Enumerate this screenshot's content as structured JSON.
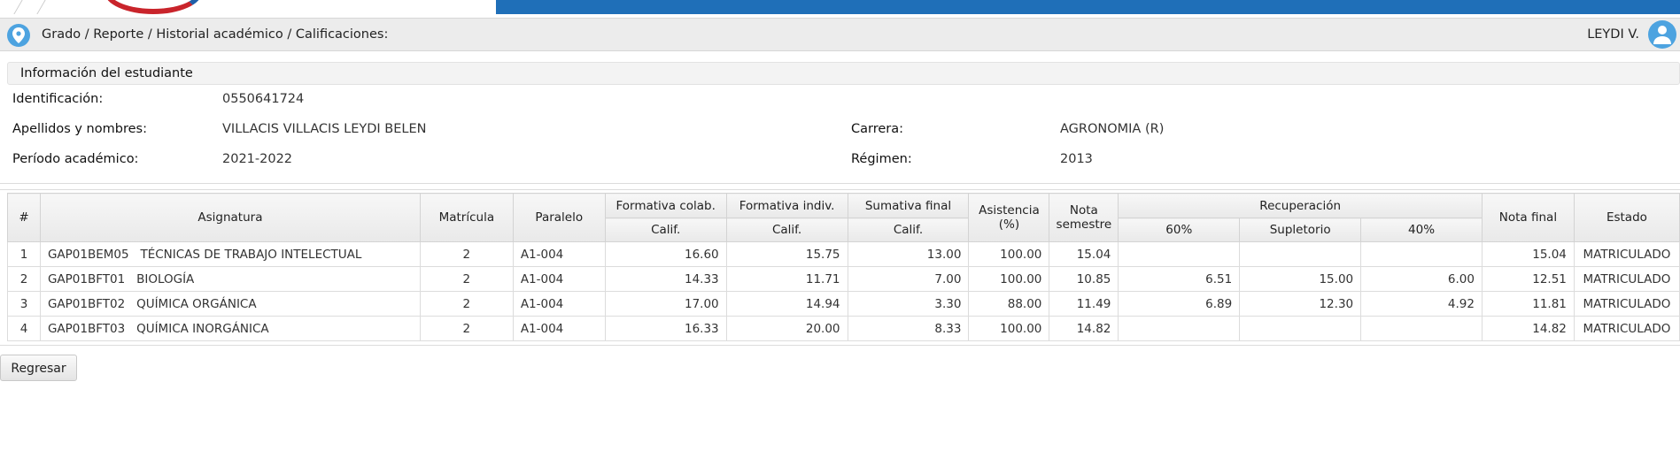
{
  "breadcrumb": "Grado / Reporte / Historial académico / Calificaciones:",
  "user": {
    "name": "LEYDI V."
  },
  "student_info": {
    "title": "Información del estudiante",
    "identificacion_label": "Identificación:",
    "identificacion": "0550641724",
    "nombres_label": "Apellidos y nombres:",
    "nombres": "VILLACIS VILLACIS LEYDI BELEN",
    "carrera_label": "Carrera:",
    "carrera": "AGRONOMIA (R)",
    "periodo_label": "Período académico:",
    "periodo": "2021-2022",
    "regimen_label": "Régimen:",
    "regimen": "2013"
  },
  "table": {
    "headers": {
      "num": "#",
      "asignatura": "Asignatura",
      "matricula": "Matrícula",
      "paralelo": "Paralelo",
      "form_colab": "Formativa colab.",
      "form_indiv": "Formativa indiv.",
      "sumativa": "Sumativa final",
      "asistencia": "Asistencia (%)",
      "nota_semestre": "Nota semestre",
      "recuperacion": "Recuperación",
      "nota_final": "Nota final",
      "estado": "Estado",
      "calif": "Calif.",
      "p60": "60%",
      "supletorio": "Supletorio",
      "p40": "40%"
    },
    "rows": [
      {
        "num": "1",
        "asignatura": "GAP01BEM05   TÉCNICAS DE TRABAJO INTELECTUAL",
        "matricula": "2",
        "paralelo": "A1-004",
        "form_colab": "16.60",
        "form_indiv": "15.75",
        "sumativa": "13.00",
        "asistencia": "100.00",
        "nota_semestre": "15.04",
        "p60": "",
        "supletorio": "",
        "p40": "",
        "nota_final": "15.04",
        "estado": "MATRICULADO"
      },
      {
        "num": "2",
        "asignatura": "GAP01BFT01   BIOLOGÍA",
        "matricula": "2",
        "paralelo": "A1-004",
        "form_colab": "14.33",
        "form_indiv": "11.71",
        "sumativa": "7.00",
        "asistencia": "100.00",
        "nota_semestre": "10.85",
        "p60": "6.51",
        "supletorio": "15.00",
        "p40": "6.00",
        "nota_final": "12.51",
        "estado": "MATRICULADO"
      },
      {
        "num": "3",
        "asignatura": "GAP01BFT02   QUÍMICA ORGÁNICA",
        "matricula": "2",
        "paralelo": "A1-004",
        "form_colab": "17.00",
        "form_indiv": "14.94",
        "sumativa": "3.30",
        "asistencia": "88.00",
        "nota_semestre": "11.49",
        "p60": "6.89",
        "supletorio": "12.30",
        "p40": "4.92",
        "nota_final": "11.81",
        "estado": "MATRICULADO"
      },
      {
        "num": "4",
        "asignatura": "GAP01BFT03   QUÍMICA INORGÁNICA",
        "matricula": "2",
        "paralelo": "A1-004",
        "form_colab": "16.33",
        "form_indiv": "20.00",
        "sumativa": "8.33",
        "asistencia": "100.00",
        "nota_semestre": "14.82",
        "p60": "",
        "supletorio": "",
        "p40": "",
        "nota_final": "14.82",
        "estado": "MATRICULADO"
      }
    ]
  },
  "actions": {
    "back_label": "Regresar"
  },
  "colors": {
    "banner_blue": "#1f6fb8",
    "icon_blue": "#4da3e0"
  }
}
